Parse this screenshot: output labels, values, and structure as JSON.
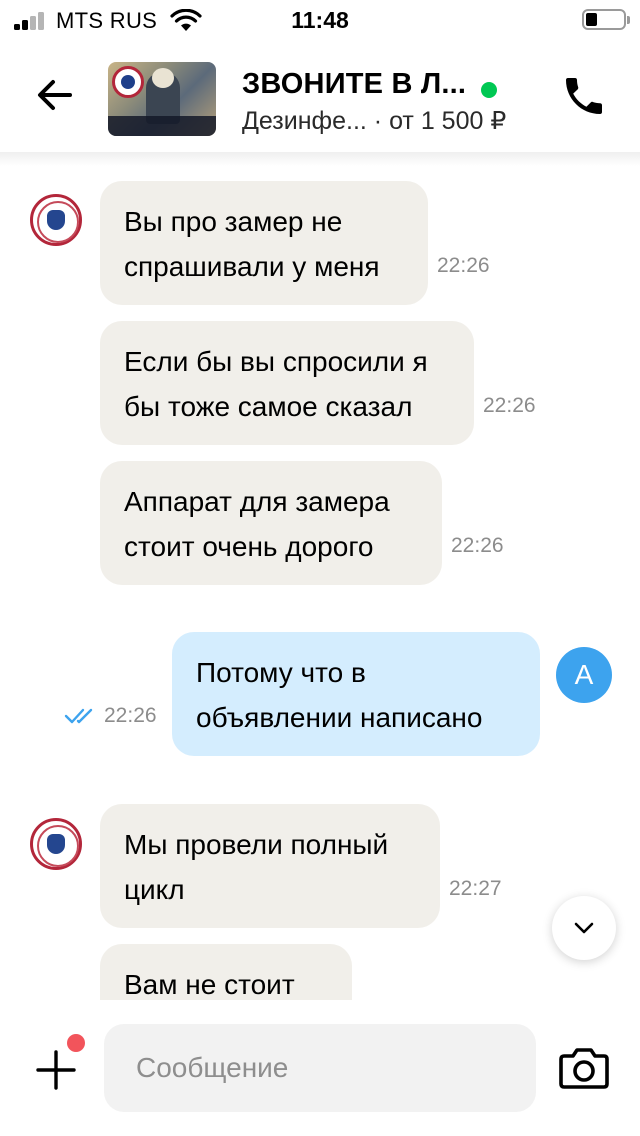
{
  "status_bar": {
    "carrier": "MTS RUS",
    "time": "11:48",
    "icons": [
      "signal-icon",
      "wifi-icon",
      "battery-icon"
    ]
  },
  "header": {
    "title": "ЗВОНИТЕ В Л...",
    "subtitle_service": "Дезинфе...",
    "subtitle_price": "от 1 500 ₽",
    "online_color": "#00c853",
    "icons": [
      "back-arrow-icon",
      "phone-icon"
    ]
  },
  "messages": [
    {
      "direction": "in",
      "text": "Вы про замер не\nспрашивали у меня",
      "time": "22:26"
    },
    {
      "direction": "in",
      "text": "Если бы вы спросили я\nбы тоже самое сказал",
      "time": "22:26"
    },
    {
      "direction": "in",
      "text": "Аппарат для замера\nстоит очень дорого",
      "time": "22:26"
    },
    {
      "direction": "out",
      "text": "Потому что в\nобъявлении написано",
      "time": "22:26",
      "status": "read"
    },
    {
      "direction": "in",
      "text": "Мы провели полный\nцикл",
      "time": "22:27"
    },
    {
      "direction": "in",
      "text": "Вам не стоит",
      "time": ""
    }
  ],
  "user_avatar_letter": "А",
  "composer": {
    "placeholder": "Сообщение",
    "icons": [
      "plus-icon",
      "camera-icon"
    ],
    "notification_dot_color": "#f2545b"
  },
  "colors": {
    "incoming_bubble": "#f1efea",
    "outgoing_bubble": "#d4edfe",
    "user_avatar": "#3da3ee",
    "read_check": "#3da3ee"
  }
}
